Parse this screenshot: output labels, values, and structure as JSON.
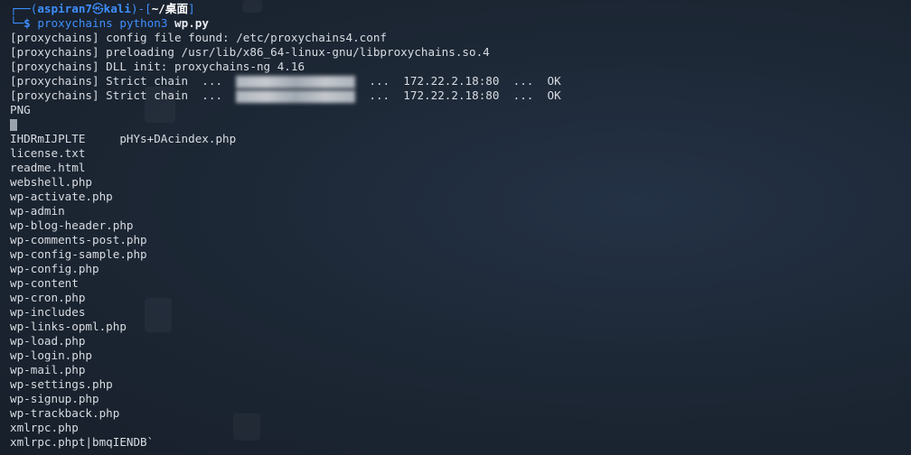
{
  "prompt": {
    "user_host_prefix": "┌──(",
    "user": "aspiran7",
    "at_symbol": "㉿",
    "host": "kali",
    "dir_open": ")-[",
    "dir": "~/桌面",
    "dir_close": "]",
    "dollar_prefix": "└─",
    "dollar": "$",
    "command": "proxychains",
    "args_plain": "python3",
    "args_bold": "wp.py"
  },
  "output": {
    "config_line": "[proxychains] config file found: /etc/proxychains4.conf",
    "preload_line": "[proxychains] preloading /usr/lib/x86_64-linux-gnu/libproxychains.so.4",
    "dll_line": "[proxychains] DLL init: proxychains-ng 4.16",
    "chain1_prefix": "[proxychains] Strict chain  ...  ",
    "chain1_suffix": "  ...  172.22.2.18:80  ...  OK",
    "chain2_prefix": "[proxychains] Strict chain  ...  ",
    "chain2_suffix": "  ...  172.22.2.18:80  ...  OK",
    "png_line": "PNG",
    "ihdr_line": "IHDRmIJPLTE     pHYs+DAcindex.php",
    "files": [
      "license.txt",
      "readme.html",
      "webshell.php",
      "wp-activate.php",
      "wp-admin",
      "wp-blog-header.php",
      "wp-comments-post.php",
      "wp-config-sample.php",
      "wp-config.php",
      "wp-content",
      "wp-cron.php",
      "wp-includes",
      "wp-links-opml.php",
      "wp-load.php",
      "wp-login.php",
      "wp-mail.php",
      "wp-settings.php",
      "wp-signup.php",
      "wp-trackback.php",
      "xmlrpc.php",
      "xmlrpc.phpt|bmqIENDB`"
    ]
  },
  "colors": {
    "background": "#1d2836",
    "prompt_blue": "#3f8fff",
    "text": "#d8dce2"
  }
}
